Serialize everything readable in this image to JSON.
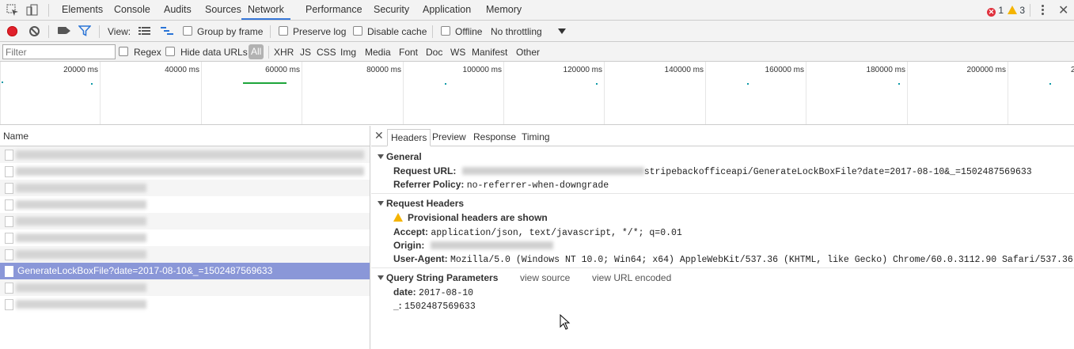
{
  "tabs": [
    "Elements",
    "Console",
    "Audits",
    "Sources",
    "Network",
    "Performance",
    "Security",
    "Application",
    "Memory"
  ],
  "active_tab": "Network",
  "errors_count": "1",
  "warnings_count": "3",
  "toolbar": {
    "view_label": "View:",
    "group_by_frame": "Group by frame",
    "preserve_log": "Preserve log",
    "disable_cache": "Disable cache",
    "offline": "Offline",
    "throttling": "No throttling"
  },
  "filterbar": {
    "filter_placeholder": "Filter",
    "regex": "Regex",
    "hide_data_urls": "Hide data URLs",
    "types": [
      "All",
      "XHR",
      "JS",
      "CSS",
      "Img",
      "Media",
      "Font",
      "Doc",
      "WS",
      "Manifest",
      "Other"
    ]
  },
  "timeline": {
    "ticks": [
      "20000 ms",
      "40000 ms",
      "60000 ms",
      "80000 ms",
      "100000 ms",
      "120000 ms",
      "140000 ms",
      "160000 ms",
      "180000 ms",
      "200000 ms",
      "2"
    ]
  },
  "list": {
    "header": "Name",
    "selected_request": "GenerateLockBoxFile?date=2017-08-10&_=1502487569633"
  },
  "detail": {
    "tabs": [
      "Headers",
      "Preview",
      "Response",
      "Timing"
    ],
    "active_tab": "Headers",
    "general": {
      "title": "General",
      "request_url_label": "Request URL:",
      "request_url_visible": "stripebackofficeapi/GenerateLockBoxFile?date=2017-08-10&_=1502487569633",
      "referrer_label": "Referrer Policy:",
      "referrer_value": "no-referrer-when-downgrade"
    },
    "request_headers": {
      "title": "Request Headers",
      "provisional": "Provisional headers are shown",
      "accept_label": "Accept:",
      "accept_value": "application/json, text/javascript, */*; q=0.01",
      "origin_label": "Origin:",
      "ua_label": "User-Agent:",
      "ua_value": "Mozilla/5.0 (Windows NT 10.0; Win64; x64) AppleWebKit/537.36 (KHTML, like Gecko) Chrome/60.0.3112.90 Safari/537.36"
    },
    "query": {
      "title": "Query String Parameters",
      "view_source": "view source",
      "view_url_encoded": "view URL encoded",
      "params": [
        {
          "key": "date:",
          "value": "2017-08-10"
        },
        {
          "key": "_:",
          "value": "1502487569633"
        }
      ]
    }
  },
  "colors": {
    "accent": "#3879d9",
    "record": "#e0202c",
    "selected_row": "#8a97d8"
  }
}
